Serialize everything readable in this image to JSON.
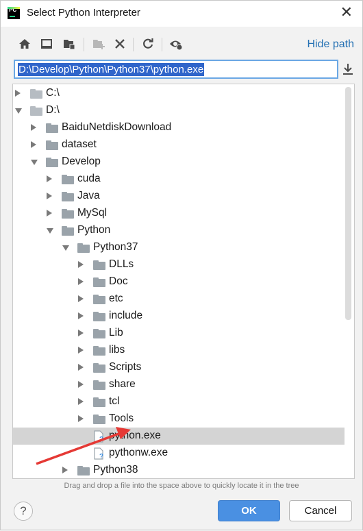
{
  "window": {
    "title": "Select Python Interpreter",
    "app_icon_text": "PC",
    "close_glyph": "✕"
  },
  "toolbar": {
    "icons": [
      "home-icon",
      "desktop-icon",
      "project-folder-icon",
      "new-folder-icon",
      "delete-icon",
      "refresh-icon",
      "show-hidden-icon"
    ],
    "hide_path_label": "Hide path"
  },
  "path": {
    "value": "D:\\Develop\\Python\\Python37\\python.exe"
  },
  "tree": {
    "items": [
      {
        "label": "C:\\",
        "depth": 0,
        "state": "collapsed",
        "kind": "drive",
        "selected": false
      },
      {
        "label": "D:\\",
        "depth": 0,
        "state": "expanded",
        "kind": "drive",
        "selected": false
      },
      {
        "label": "BaiduNetdiskDownload",
        "depth": 1,
        "state": "collapsed",
        "kind": "folder",
        "selected": false
      },
      {
        "label": "dataset",
        "depth": 1,
        "state": "collapsed",
        "kind": "folder",
        "selected": false
      },
      {
        "label": "Develop",
        "depth": 1,
        "state": "expanded",
        "kind": "folder",
        "selected": false
      },
      {
        "label": "cuda",
        "depth": 2,
        "state": "collapsed",
        "kind": "folder",
        "selected": false
      },
      {
        "label": "Java",
        "depth": 2,
        "state": "collapsed",
        "kind": "folder",
        "selected": false
      },
      {
        "label": "MySql",
        "depth": 2,
        "state": "collapsed",
        "kind": "folder",
        "selected": false
      },
      {
        "label": "Python",
        "depth": 2,
        "state": "expanded",
        "kind": "folder",
        "selected": false
      },
      {
        "label": "Python37",
        "depth": 3,
        "state": "expanded",
        "kind": "folder",
        "selected": false
      },
      {
        "label": "DLLs",
        "depth": 4,
        "state": "collapsed",
        "kind": "folder",
        "selected": false
      },
      {
        "label": "Doc",
        "depth": 4,
        "state": "collapsed",
        "kind": "folder",
        "selected": false
      },
      {
        "label": "etc",
        "depth": 4,
        "state": "collapsed",
        "kind": "folder",
        "selected": false
      },
      {
        "label": "include",
        "depth": 4,
        "state": "collapsed",
        "kind": "folder",
        "selected": false
      },
      {
        "label": "Lib",
        "depth": 4,
        "state": "collapsed",
        "kind": "folder",
        "selected": false
      },
      {
        "label": "libs",
        "depth": 4,
        "state": "collapsed",
        "kind": "folder",
        "selected": false
      },
      {
        "label": "Scripts",
        "depth": 4,
        "state": "collapsed",
        "kind": "folder",
        "selected": false
      },
      {
        "label": "share",
        "depth": 4,
        "state": "collapsed",
        "kind": "folder",
        "selected": false
      },
      {
        "label": "tcl",
        "depth": 4,
        "state": "collapsed",
        "kind": "folder",
        "selected": false
      },
      {
        "label": "Tools",
        "depth": 4,
        "state": "collapsed",
        "kind": "folder",
        "selected": false
      },
      {
        "label": "python.exe",
        "depth": 4,
        "state": "leaf",
        "kind": "file",
        "selected": true
      },
      {
        "label": "pythonw.exe",
        "depth": 4,
        "state": "leaf",
        "kind": "file",
        "selected": false
      },
      {
        "label": "Python38",
        "depth": 3,
        "state": "collapsed",
        "kind": "folder",
        "selected": false
      }
    ]
  },
  "hint": "Drag and drop a file into the space above to quickly locate it in the tree",
  "footer": {
    "help_glyph": "?",
    "ok_label": "OK",
    "cancel_label": "Cancel"
  },
  "colors": {
    "accent": "#4a90e2",
    "link": "#2470b3",
    "selection": "#2f65ca",
    "annotation_arrow": "#e53935"
  }
}
